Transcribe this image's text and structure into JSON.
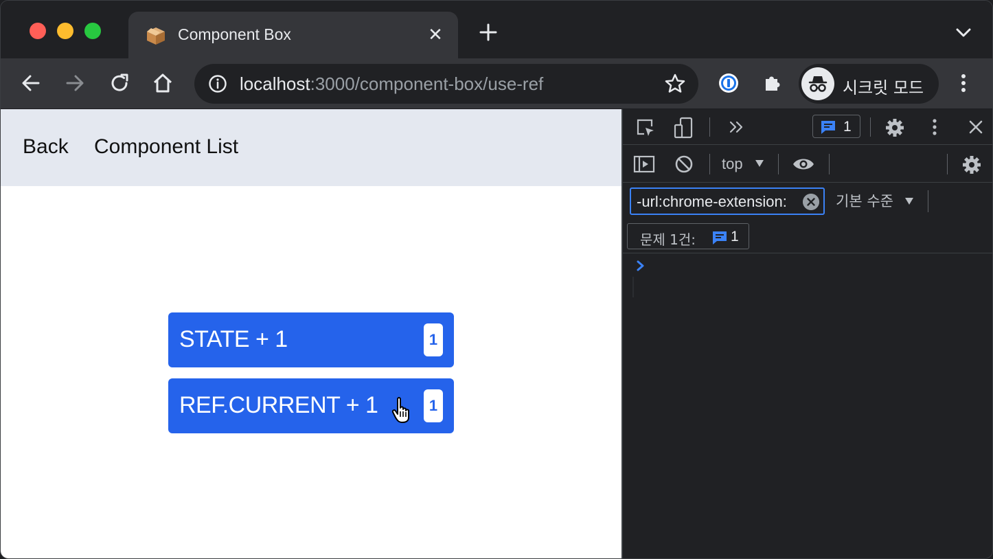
{
  "browser": {
    "tab": {
      "title": "Component Box",
      "close_glyph": "✕"
    },
    "address_bar": {
      "host": "localhost",
      "rest": ":3000/component-box/use-ref"
    },
    "profile": {
      "label": "시크릿 모드"
    }
  },
  "page": {
    "nav": {
      "back_label": "Back",
      "list_label": "Component List"
    },
    "buttons": [
      {
        "label": "STATE + 1",
        "count": "1"
      },
      {
        "label": "REF.CURRENT + 1",
        "count": "1"
      }
    ],
    "accent_color": "#2563eb"
  },
  "devtools": {
    "issues_badge_count": "1",
    "context": "top",
    "filter_value": "-url:chrome-extension:",
    "levels_label": "기본 수준",
    "issues_summary_label": "문제 1건:",
    "issues_summary_count": "1"
  }
}
